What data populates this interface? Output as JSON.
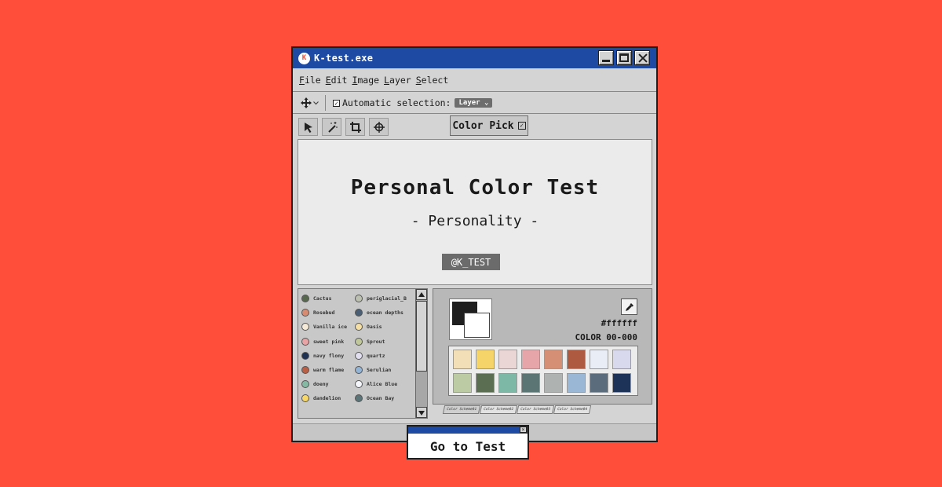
{
  "window": {
    "title": "K-test.exe",
    "icon_letter": "K"
  },
  "menu": [
    "File",
    "Edit",
    "Image",
    "Layer",
    "Select"
  ],
  "options": {
    "auto_select_label": "Automatic selection:",
    "auto_select_checked": true,
    "layer_select": "Layer"
  },
  "tools": [
    "arrow-icon",
    "magic-wand-icon",
    "crop-icon",
    "crosshair-icon"
  ],
  "color_pick": {
    "label": "Color Pick"
  },
  "canvas": {
    "title": "Personal Color Test",
    "subtitle": "- Personality -",
    "handle": "@K_TEST"
  },
  "palette": {
    "items": [
      {
        "name": "Cactus",
        "color": "#58684f"
      },
      {
        "name": "periglacial_B",
        "color": "#bcc0b0"
      },
      {
        "name": "Rosebud",
        "color": "#d78c72"
      },
      {
        "name": "ocean depths",
        "color": "#4a5f74"
      },
      {
        "name": "Vanilla ice",
        "color": "#f5ead8"
      },
      {
        "name": "Oasis",
        "color": "#f5dfa5"
      },
      {
        "name": "sweet pink",
        "color": "#e8a3a4"
      },
      {
        "name": "Sprout",
        "color": "#c0c79b"
      },
      {
        "name": "navy flony",
        "color": "#1f3253"
      },
      {
        "name": "quartz",
        "color": "#e0deef"
      },
      {
        "name": "warm flame",
        "color": "#b85f45"
      },
      {
        "name": "Serulian",
        "color": "#94b4d6"
      },
      {
        "name": "doeny",
        "color": "#86b9a3"
      },
      {
        "name": "Alice Blue",
        "color": "#f4f6fb"
      },
      {
        "name": "dandelion",
        "color": "#f7d767"
      },
      {
        "name": "Ocean Bay",
        "color": "#5a7478"
      }
    ]
  },
  "picker": {
    "hex": "#ffffff",
    "code": "COLOR 00-000",
    "swatches": [
      "#f3dfb7",
      "#f5d469",
      "#ead6d4",
      "#e6a6a9",
      "#d48f74",
      "#ad5a40",
      "#e9eef6",
      "#d9d9ee",
      "#bccba4",
      "#5c6e52",
      "#7db7a6",
      "#5b7575",
      "#aeb3b1",
      "#9ab7d5",
      "#5b6c7d",
      "#1d3458"
    ],
    "tabs": [
      "Color Scheme01",
      "Color Scheme02",
      "Color Scheme03",
      "Color Scheme04"
    ]
  },
  "popup": {
    "button": "Go to Test"
  }
}
